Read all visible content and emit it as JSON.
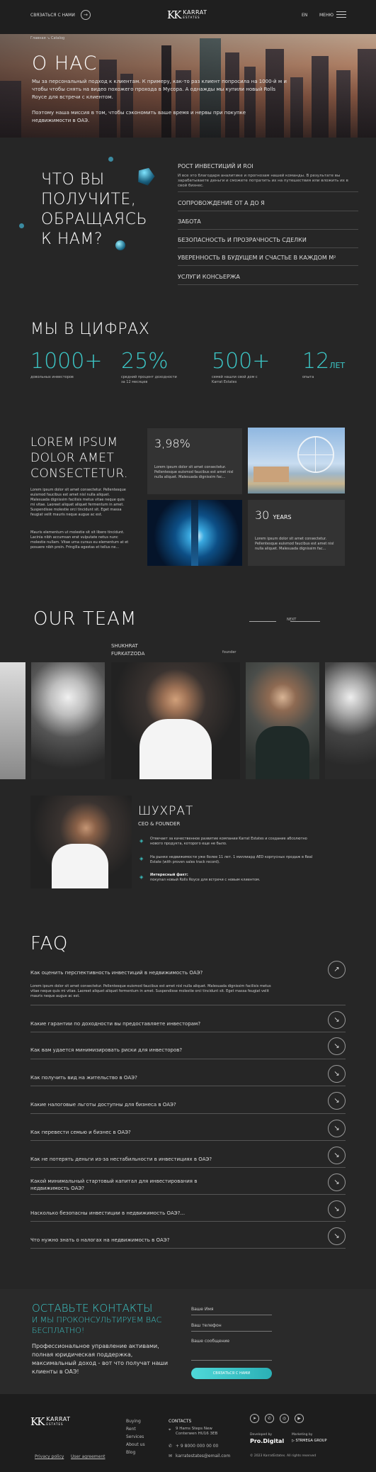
{
  "header": {
    "contact": "СВЯЗАТЬСЯ С НАМИ",
    "logo": "KARRAT",
    "logo_sub": "ESTATES",
    "lang": "EN",
    "menu": "МЕНЮ"
  },
  "breadcrumb": {
    "home": "Главная",
    "current": "Catalog"
  },
  "hero": {
    "title": "О НАС",
    "p1": "Мы за персональный подход к клиентам. К примеру, как-то раз клиент попросила на 1000-й м и чтобы чтобы снять на видео похожего прохода в Мусора. А однажды мы купили новый Rolls Royce для встречи с клиентом.",
    "p2": "Поэтому наша миссия в том, чтобы сэкономить ваше время и нервы при покупке недвижимости в ОАЭ."
  },
  "why": {
    "title": [
      "ЧТО ВЫ",
      "ПОЛУЧИТЕ,",
      "ОБРАЩАЯСЬ",
      "К НАМ?"
    ],
    "first": "РОСТ ИНВЕСТИЦИЙ И ROI",
    "first_text": "И все это благодаря аналитике и прогнозам нашей команды. В результате вы зарабатываете деньги и сможете потратить их на путешествия или вложить их в свой бизнес.",
    "items": [
      "СОПРОВОЖДЕНИЕ ОТ А ДО Я",
      "ЗАБОТА",
      "БЕЗОПАСНОСТЬ И ПРОЗРАЧНОСТЬ СДЕЛКИ",
      "УВЕРЕННОСТЬ В БУДУЩЕМ И СЧАСТЬЕ В КАЖДОМ М²",
      "УСЛУГИ КОНСЬЕРЖА"
    ]
  },
  "numbers": {
    "title": "МЫ В ЦИФРАХ",
    "items": [
      {
        "v": "1000+",
        "u": "",
        "c": "довольных инвесторов"
      },
      {
        "v": "25%",
        "u": "",
        "c": "средний процент доходности за 12 месяцев"
      },
      {
        "v": "500+",
        "u": "",
        "c": "семей нашли свой дом с Karrat Estates"
      },
      {
        "v": "12",
        "u": "ЛЕТ",
        "c": "опыта"
      }
    ]
  },
  "lorem": {
    "title": [
      "LOREM IPSUM",
      "DOLOR  AMET",
      "CONSECTETUR."
    ],
    "p1": "Lorem ipsum dolor sit amet consectetur. Pellentesque euismod faucibus est amet nisl nulla aliquet. Malesuada dignissim facilisis metus vitae neque quis mi vitae. Laoreet aliquet aliquet fermentum in amet. Suspendisse molestie orci tincidunt sit. Eget massa feugiat velit mauris neque augue ac est.",
    "p2": "Mauris elementum ut molestie sit sit libero tincidunt. Lacinia nibh accumsan erat vulputate netus nunc molestie nullam. Vitae urna cursus eu elementum at et posuere nibh proin. Fringilla egestas et tellus ne...",
    "c1v": "3,98%",
    "c1t": "Lorem ipsum dolor sit amet consectetur. Pellentesque euismod faucibus est amet nisl nulla aliquet. Malesuada dignissim fac...",
    "c2v": "30",
    "c2u": "YEARS",
    "c2t": "Lorem ipsum dolor sit amet consectetur. Pellentesque euismod faucibus est amet nisl nulla aliquet. Malesuada dignissim fac..."
  },
  "team": {
    "title": "OUR TEAM",
    "next": "NEXT",
    "featured_name": "SHUKHRAT FURKATZODA",
    "featured_role": "founder"
  },
  "profile": {
    "name": "ШУХРАТ",
    "role": "CEO & FOUNDER",
    "f1": "Отвечает за качественное развитие компании Karrat Estates и создание абсолютно нового продукта, которого еще не было.",
    "f2": "На рынке недвижимости уже более 11 лет. 1 миллиард AED корпусных продаж в Real Estate (with proven sales track record).",
    "f3h": "Интересный факт:",
    "f3": "покупал новый Rolls Royce для встречи с новым клиентом."
  },
  "faq": {
    "title": "FAQ",
    "open_q": "Как оценить перспективность инвестиций в недвижимость ОАЭ?",
    "open_a": "Lorem ipsum dolor sit amet consectetur. Pellentesque euismod faucibus est amet nisl nulla aliquet. Malesuada dignissim facilisis metus vitae neque quis mi vitae. Laoreet aliquet aliquet fermentum in amet. Suspendisse molestie orci tincidunt sit. Eget massa feugiat velit mauris neque augue ac est.",
    "q": [
      "Какие гарантии по доходности вы предоставляете инвесторам?",
      "Как вам удается минимизировать риски для инвесторов?",
      "Как получить вид на жительство в ОАЭ?",
      "Какие налоговые льготы доступны для бизнеса в ОАЭ?",
      "Как перевести семью и бизнес в ОАЭ?",
      "Как не потерять деньги из-за нестабильности в инвестициях в ОАЭ?",
      "Какой минимальный стартовый капитал для инвестирования в недвижимость ОАЭ?",
      "Насколько безопасны инвестиции в недвижимость ОАЭ?...",
      "Что нужно знать о налогах на недвижимость в ОАЭ?"
    ]
  },
  "contact": {
    "t1": "ОСТАВЬТЕ КОНТАКТЫ",
    "t2": "И МЫ ПРОКОНСУЛЬТИРУЕМ ВАС",
    "t3": "БЕСПЛАТНО!",
    "p": "Профессиональное управление активами, полная юридическая поддержка, максимальный доход - вот что получат наши клиенты в ОАЭ!",
    "name": "Ваше Имя",
    "phone": "Ваш телефон",
    "msg": "Ваше сообщение",
    "btn": "СВЯЗАТЬСЯ С НАМИ"
  },
  "footer": {
    "links": [
      "Buying",
      "Rent",
      "Services",
      "About us",
      "Blog"
    ],
    "contacts": "CONTACTS",
    "addr": "9 Hams Steps New Conterwen HU16 3EB",
    "phone": "+ 9 8000 000 00 00",
    "email": "karratestates@email.com",
    "policy": "Privacy policy",
    "agreement": "User agreement",
    "dev": "Developed by",
    "dev_name": "Pro.Digital",
    "mkt": "Marketing by",
    "mkt_name": "STRMEGA GROUP",
    "copy": "© 2023 KarratEstates. All rights reserved"
  }
}
